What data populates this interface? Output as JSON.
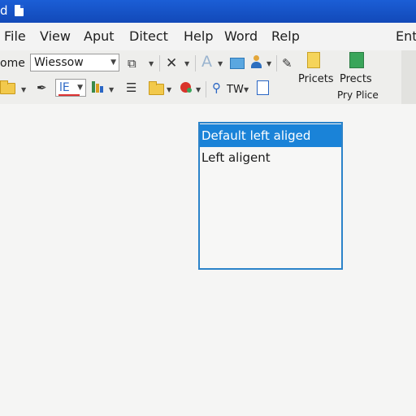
{
  "window": {
    "title": "d"
  },
  "menu": {
    "items": [
      "File",
      "View",
      "Aput",
      "Ditect",
      "Help",
      "Word",
      "Relp",
      "Ent"
    ]
  },
  "toolbar": {
    "home_label": "ome",
    "font_combo_value": "Wiessow",
    "tw_label": "TW",
    "le_label": "lE",
    "pricets_label": "Pricets",
    "prects_label": "Prects",
    "pryplice_label": "Pry Plice"
  },
  "listbox": {
    "items": [
      {
        "label": "Default left aliged",
        "selected": true
      },
      {
        "label": "Left aligent",
        "selected": false
      }
    ]
  },
  "colors": {
    "titlebar": "#1b5ed6",
    "selection": "#1a83d8",
    "listbox_border": "#2b83c9"
  },
  "icons": [
    "document-icon",
    "format-painter-icon",
    "close-x-icon",
    "font-color-icon",
    "folder-icon",
    "user-icon",
    "pen-icon",
    "paragraph-icon",
    "list-icon",
    "palette-icon",
    "hook-icon",
    "page-icon",
    "dropdown-arrow-icon"
  ]
}
